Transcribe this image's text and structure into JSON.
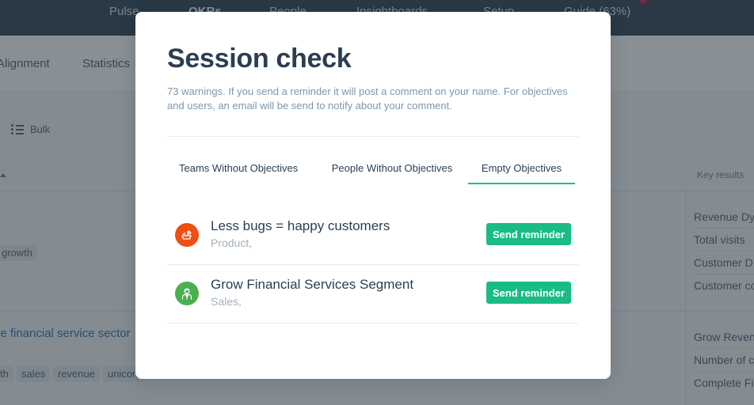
{
  "topnav": {
    "items": [
      {
        "label": "Pulse",
        "active": false
      },
      {
        "label": "OKRs",
        "active": true
      },
      {
        "label": "People",
        "active": false
      },
      {
        "label": "Insightboards",
        "active": false
      },
      {
        "label": "Setup",
        "active": false
      },
      {
        "label": "Guide (63%)",
        "active": false
      }
    ]
  },
  "subnav": {
    "items": [
      "Alignment",
      "Statistics"
    ]
  },
  "toolbar": {
    "bulk_label": "Bulk"
  },
  "table": {
    "key_results_header": "Key results",
    "rows": [
      {
        "tags": [
          "growth"
        ],
        "key_results": [
          "Revenue Dy",
          "Total visits",
          "Customer D",
          "Customer co"
        ]
      },
      {
        "title": "he financial service sector",
        "tags": [
          "th",
          "sales",
          "revenue",
          "unicorn"
        ],
        "key_results": [
          "Grow Reven",
          "Number of c",
          "Complete Fi"
        ]
      }
    ]
  },
  "modal": {
    "title": "Session check",
    "description": "73 warnings. If you send a reminder it will post a comment on your name. For objectives and users, an email will be send to notify about your comment.",
    "tabs": [
      {
        "label": "Teams Without Objectives",
        "active": false
      },
      {
        "label": "People Without Objectives",
        "active": false
      },
      {
        "label": "Empty Objectives",
        "active": true
      }
    ],
    "items": [
      {
        "title": "Less bugs = happy customers",
        "team": "Product,",
        "icon": "bug-spray-icon",
        "icon_color": "#f04e12",
        "action_label": "Send reminder"
      },
      {
        "title": "Grow Financial Services Segment",
        "team": "Sales,",
        "icon": "person-icon",
        "icon_color": "#4caf50",
        "action_label": "Send reminder"
      }
    ]
  },
  "colors": {
    "accent": "#1abc9c",
    "button": "#1abc85",
    "nav_bg": "#2c3e50",
    "notification": "#e6174f"
  }
}
